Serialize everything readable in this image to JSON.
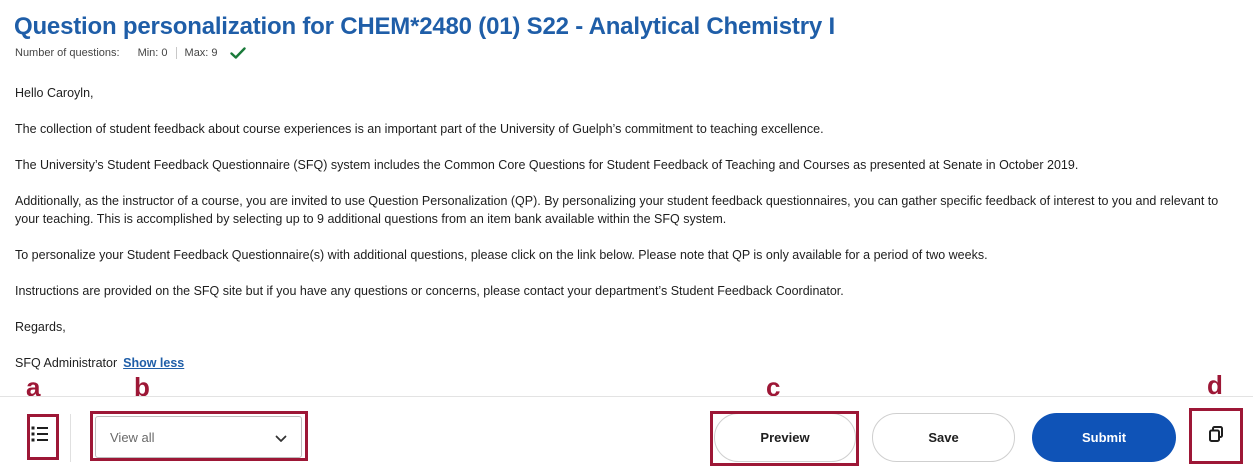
{
  "header": {
    "title": "Question personalization for CHEM*2480 (01) S22 - Analytical Chemistry I",
    "num_questions_label": "Number of questions:",
    "min_label": "Min: 0",
    "max_label": "Max: 9",
    "status_icon": "checkmark-icon"
  },
  "message": {
    "greeting": "Hello Caroyln,",
    "p1": "The collection of student feedback about course experiences is an important part of the University of Guelph’s commitment to teaching excellence.",
    "p2": "The University’s Student Feedback Questionnaire (SFQ) system includes the Common Core Questions for Student Feedback of Teaching and Courses as presented at Senate in October 2019.",
    "p3": "Additionally, as the instructor of a course, you are invited to use Question Personalization (QP). By personalizing your student feedback questionnaires, you can gather specific feedback of interest to you and relevant to your teaching. This is accomplished by selecting up to 9 additional questions from an item bank available within the SFQ system.",
    "p4": "To personalize your Student Feedback Questionnaire(s) with additional questions, please click on the link below. Please note that QP is only available for a period of two weeks.",
    "p5": "Instructions are provided on the SFQ site but if you have any questions or concerns, please contact your department’s Student Feedback Coordinator.",
    "closing": "Regards,",
    "signature": "SFQ Administrator",
    "show_less": "Show less"
  },
  "annotations": {
    "a": "a",
    "b": "b",
    "c": "c",
    "d": "d"
  },
  "footer": {
    "list_icon": "list-icon",
    "view_select_value": "View all",
    "preview_label": "Preview",
    "save_label": "Save",
    "submit_label": "Submit",
    "copy_icon": "copy-icon"
  },
  "colors": {
    "title": "#1f5ea8",
    "check": "#1a7a3a",
    "annotation": "#9d1736",
    "submit_bg": "#0f53b7"
  }
}
